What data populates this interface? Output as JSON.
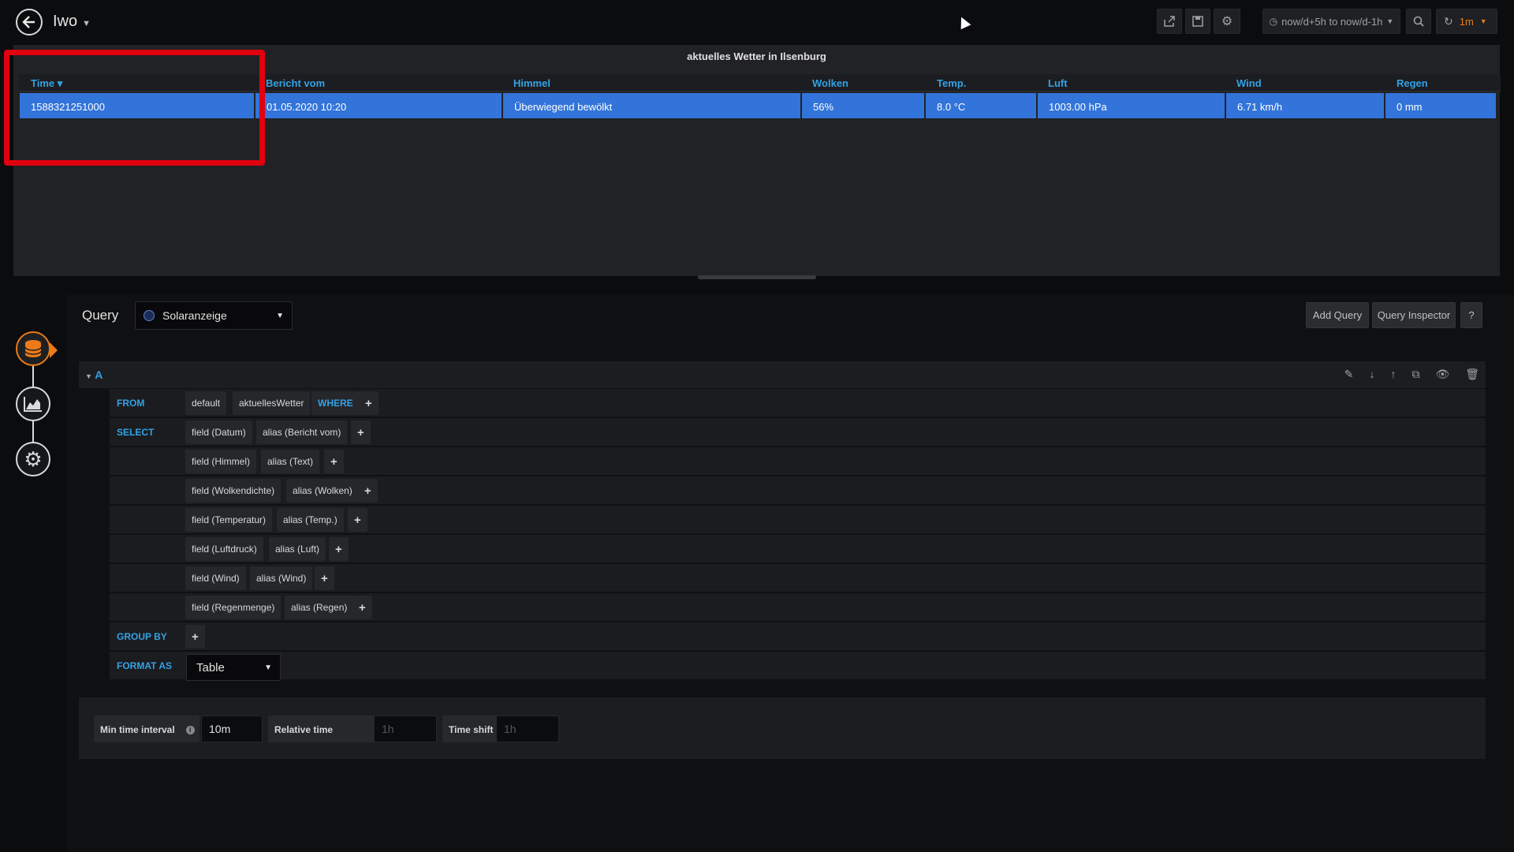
{
  "dashboard": {
    "title": "Iwo"
  },
  "toolbar": {
    "share_icon": "share-icon",
    "save_icon": "save-icon",
    "settings_icon": "gear-icon",
    "time_range": "now/d+5h to now/d-1h",
    "refresh_interval": "1m"
  },
  "panel": {
    "title": "aktuelles Wetter in Ilsenburg",
    "columns": [
      "Time",
      "Bericht vom",
      "Himmel",
      "Wolken",
      "Temp.",
      "Luft",
      "Wind",
      "Regen"
    ],
    "sort_indicator": "▾",
    "rows": [
      [
        "1588321251000",
        "01.05.2020 10:20",
        "Überwiegend bewölkt",
        "56%",
        "8.0 °C",
        "1003.00 hPa",
        "6.71 km/h",
        "0 mm"
      ]
    ]
  },
  "query_editor": {
    "header": "Query",
    "datasource": "Solaranzeige",
    "add_query": "Add Query",
    "query_inspector": "Query Inspector",
    "help": "?",
    "ref_id": "A",
    "from": {
      "keyword": "FROM",
      "policy": "default",
      "measurement": "aktuellesWetter",
      "where": "WHERE"
    },
    "select": {
      "keyword": "SELECT",
      "fields": [
        {
          "field": "field (Datum)",
          "alias": "alias (Bericht vom)"
        },
        {
          "field": "field (Himmel)",
          "alias": "alias (Text)"
        },
        {
          "field": "field (Wolkendichte)",
          "alias": "alias (Wolken)"
        },
        {
          "field": "field (Temperatur)",
          "alias": "alias (Temp.)"
        },
        {
          "field": "field (Luftdruck)",
          "alias": "alias (Luft)"
        },
        {
          "field": "field (Wind)",
          "alias": "alias (Wind)"
        },
        {
          "field": "field (Regenmenge)",
          "alias": "alias (Regen)"
        }
      ]
    },
    "group_by": "GROUP BY",
    "format_as": {
      "label": "FORMAT AS",
      "value": "Table"
    },
    "plus": "+"
  },
  "options": {
    "min_interval_label": "Min time interval",
    "min_interval_value": "10m",
    "relative_time_label": "Relative time",
    "relative_time_placeholder": "1h",
    "time_shift_label": "Time shift",
    "time_shift_placeholder": "1h"
  },
  "colors": {
    "accent": "#33a2e5",
    "selected_row": "#3274d9",
    "highlight": "#e0000f",
    "active_step": "#eb7b18"
  }
}
